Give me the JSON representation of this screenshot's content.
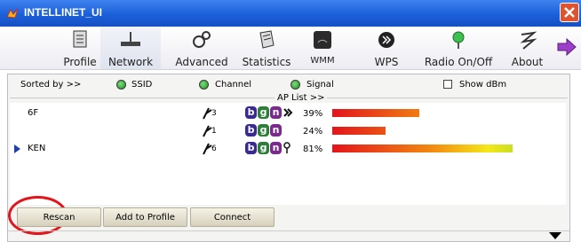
{
  "window": {
    "title": "INTELLINET_UI"
  },
  "toolbar": {
    "items": [
      {
        "label": "Profile",
        "icon": "profile-icon"
      },
      {
        "label": "Network",
        "icon": "network-icon"
      },
      {
        "label": "Advanced",
        "icon": "gears-icon"
      },
      {
        "label": "Statistics",
        "icon": "notepad-icon"
      },
      {
        "label": "WMM",
        "icon": "wmm-icon"
      },
      {
        "label": "WPS",
        "icon": "wps-icon"
      },
      {
        "label": "Radio On/Off",
        "icon": "radio-icon"
      },
      {
        "label": "About",
        "icon": "about-icon"
      }
    ],
    "active": "Network"
  },
  "sortbar": {
    "sorted_by": "Sorted by >>",
    "ssid": "SSID",
    "channel": "Channel",
    "signal": "Signal",
    "show_dbm": "Show dBm",
    "ap_list": "AP List >>"
  },
  "networks": [
    {
      "ssid": "6F",
      "channel": "3",
      "badges": [
        "b",
        "g",
        "n"
      ],
      "extra": "wps",
      "signal_pct": "39%",
      "signal": 39,
      "selected": false
    },
    {
      "ssid": "",
      "channel": "1",
      "badges": [
        "b",
        "g",
        "n"
      ],
      "extra": "",
      "signal_pct": "24%",
      "signal": 24,
      "selected": false
    },
    {
      "ssid": "KEN",
      "channel": "6",
      "badges": [
        "b",
        "g",
        "n"
      ],
      "extra": "key",
      "signal_pct": "81%",
      "signal": 81,
      "selected": true
    }
  ],
  "buttons": {
    "rescan": "Rescan",
    "add_to_profile": "Add to Profile",
    "connect": "Connect"
  },
  "colors": {
    "titlebar": "#1b5fd9",
    "badge_b": "#3a2a8f",
    "badge_g": "#2e7d3a",
    "badge_n": "#7a2a8a",
    "highlight": "#e3141b"
  }
}
